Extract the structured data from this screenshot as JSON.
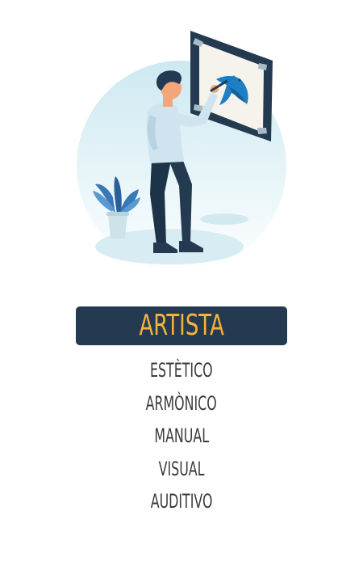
{
  "card": {
    "title": "ARTISTA",
    "traits": [
      {
        "label": "ESTÈTICO"
      },
      {
        "label": "ARMÒNICO"
      },
      {
        "label": "MANUAL"
      },
      {
        "label": "VISUAL"
      },
      {
        "label": "AUDITIVO"
      }
    ]
  },
  "colors": {
    "banner": "#233a51",
    "title": "#f7b239",
    "trait_text": "#3b3b3b",
    "accent_blue": "#1e7fc5"
  },
  "illustration": {
    "subject": "person-painting-bird-on-canvas-icon",
    "plant": "potted-plant-icon"
  }
}
